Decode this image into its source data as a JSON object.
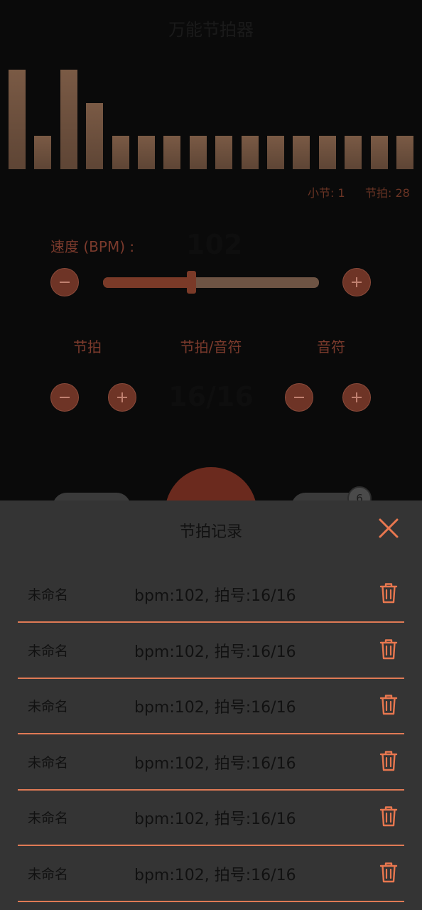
{
  "app": {
    "title": "万能节拍器"
  },
  "visualizer": {
    "bar_levels": [
      3,
      1,
      3,
      2,
      1,
      1,
      1,
      1,
      1,
      1,
      1,
      1,
      1,
      1,
      1,
      1
    ]
  },
  "counter": {
    "measure_label": "小节: 1",
    "beat_label": "节拍: 28"
  },
  "tempo": {
    "label": "速度 (BPM) :",
    "value": "102",
    "slider_fraction": 0.41
  },
  "signature": {
    "beats_label": "节拍",
    "sig_label": "节拍/音符",
    "note_label": "音符",
    "value": "16/16"
  },
  "records_badge": "6",
  "sheet": {
    "title": "节拍记录",
    "records": [
      {
        "name": "未命名",
        "info": "bpm:102, 拍号:16/16"
      },
      {
        "name": "未命名",
        "info": "bpm:102, 拍号:16/16"
      },
      {
        "name": "未命名",
        "info": "bpm:102, 拍号:16/16"
      },
      {
        "name": "未命名",
        "info": "bpm:102, 拍号:16/16"
      },
      {
        "name": "未命名",
        "info": "bpm:102, 拍号:16/16"
      },
      {
        "name": "未命名",
        "info": "bpm:102, 拍号:16/16"
      }
    ]
  },
  "colors": {
    "accent": "#E8774F",
    "background": "#0A0A0A",
    "sheet": "#343434"
  },
  "icons": {
    "minus": "minus-icon",
    "plus": "plus-icon",
    "close": "close-icon",
    "delete": "trash-icon"
  }
}
